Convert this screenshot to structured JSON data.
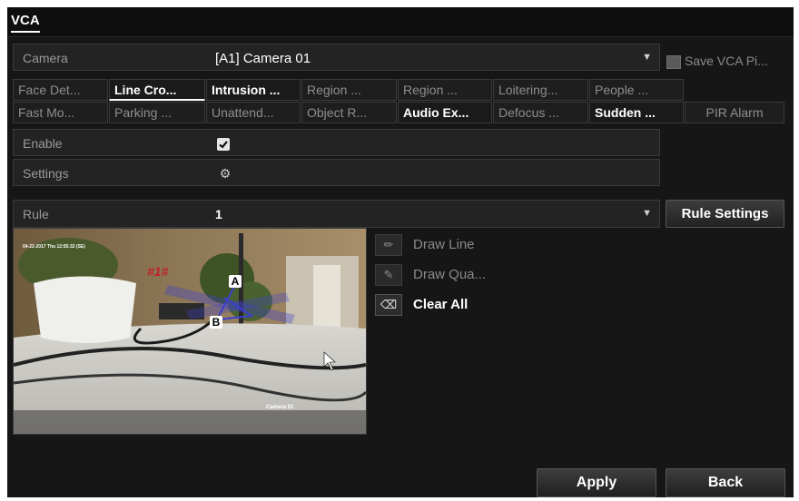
{
  "window": {
    "title": "VCA"
  },
  "camera": {
    "label": "Camera",
    "value": "[A1] Camera 01",
    "save_vca_label": "Save VCA Pi..."
  },
  "tabs_row1": [
    {
      "label": "Face Det...",
      "active": false
    },
    {
      "label": "Line Cro...",
      "active": true
    },
    {
      "label": "Intrusion ...",
      "active": true
    },
    {
      "label": "Region ...",
      "active": false
    },
    {
      "label": "Region ...",
      "active": false
    },
    {
      "label": "Loitering...",
      "active": false
    },
    {
      "label": "People ...",
      "active": false
    }
  ],
  "tabs_row2": [
    {
      "label": "Fast Mo...",
      "active": false
    },
    {
      "label": "Parking ...",
      "active": false
    },
    {
      "label": "Unattend...",
      "active": false
    },
    {
      "label": "Object R...",
      "active": false
    },
    {
      "label": "Audio Ex...",
      "active": true
    },
    {
      "label": "Defocus ...",
      "active": false
    },
    {
      "label": "Sudden ...",
      "active": true
    },
    {
      "label": "PIR Alarm",
      "active": false
    }
  ],
  "enable": {
    "label": "Enable",
    "checked": true
  },
  "settings": {
    "label": "Settings",
    "icon": "gear-icon"
  },
  "rule": {
    "label": "Rule",
    "value": "1",
    "settings_button": "Rule Settings"
  },
  "preview": {
    "date_overlay": "04-22-2017 Thu 12:55:32 (SE)",
    "camera_overlay": "Camera 01",
    "rule_tag": "#1#",
    "point_a": "A",
    "point_b": "B"
  },
  "tools": {
    "draw_line": "Draw Line",
    "draw_quad": "Draw Qua...",
    "clear_all": "Clear All"
  },
  "footer": {
    "apply": "Apply",
    "back": "Back"
  },
  "colors": {
    "background": "#161616",
    "rule_tag": "#c0202a",
    "line": "#3b3fd0"
  }
}
